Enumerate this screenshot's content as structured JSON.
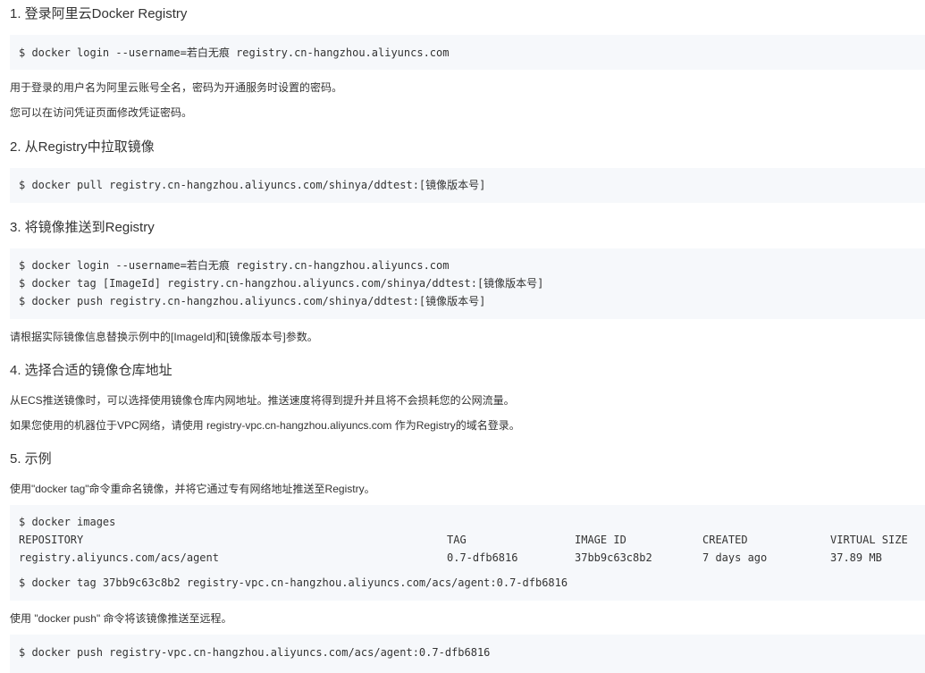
{
  "sections": [
    {
      "heading": "1. 登录阿里云Docker Registry"
    },
    {
      "heading": "2. 从Registry中拉取镜像"
    },
    {
      "heading": "3. 将镜像推送到Registry"
    },
    {
      "heading": "4. 选择合适的镜像仓库地址"
    },
    {
      "heading": "5. 示例"
    }
  ],
  "s1": {
    "code": "$ docker login --username=若白无痕 registry.cn-hangzhou.aliyuncs.com",
    "note1": "用于登录的用户名为阿里云账号全名，密码为开通服务时设置的密码。",
    "note2": "您可以在访问凭证页面修改凭证密码。"
  },
  "s2": {
    "code": "$ docker pull registry.cn-hangzhou.aliyuncs.com/shinya/ddtest:[镜像版本号]"
  },
  "s3": {
    "lines": [
      "$ docker login --username=若白无痕 registry.cn-hangzhou.aliyuncs.com",
      "$ docker tag [ImageId] registry.cn-hangzhou.aliyuncs.com/shinya/ddtest:[镜像版本号]",
      "$ docker push registry.cn-hangzhou.aliyuncs.com/shinya/ddtest:[镜像版本号]"
    ],
    "note": "请根据实际镜像信息替换示例中的[ImageId]和[镜像版本号]参数。"
  },
  "s4": {
    "note1": "从ECS推送镜像时，可以选择使用镜像仓库内网地址。推送速度将得到提升并且将不会损耗您的公网流量。",
    "note2": "如果您使用的机器位于VPC网络，请使用 registry-vpc.cn-hangzhou.aliyuncs.com 作为Registry的域名登录。"
  },
  "s5": {
    "intro": "使用\"docker tag\"命令重命名镜像，并将它通过专有网络地址推送至Registry。",
    "cmd_images": "$ docker images",
    "table": {
      "headers": [
        "REPOSITORY",
        "TAG",
        "IMAGE ID",
        "CREATED",
        "VIRTUAL SIZE"
      ],
      "row": [
        "registry.aliyuncs.com/acs/agent",
        "0.7-dfb6816",
        "37bb9c63c8b2",
        "7 days ago",
        "37.89 MB"
      ]
    },
    "cmd_tag": "$ docker tag 37bb9c63c8b2 registry-vpc.cn-hangzhou.aliyuncs.com/acs/agent:0.7-dfb6816",
    "push_note": "使用 \"docker push\" 命令将该镜像推送至远程。",
    "cmd_push": "$ docker push registry-vpc.cn-hangzhou.aliyuncs.com/acs/agent:0.7-dfb6816"
  }
}
